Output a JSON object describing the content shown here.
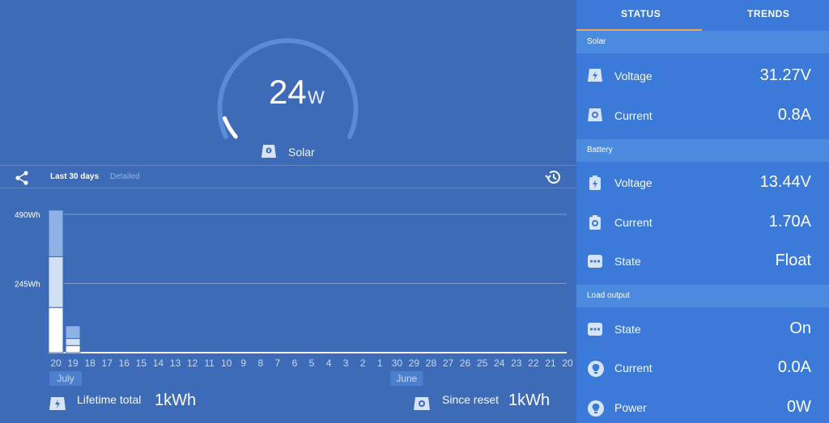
{
  "gauge": {
    "value": "24",
    "unit": "W",
    "label": "Solar",
    "level_fraction": 0.07
  },
  "toolbar": {
    "range_tab": "Last 30 days",
    "detail_tab": "Detailed"
  },
  "chart_data": {
    "type": "bar",
    "y_ticks": [
      "490Wh",
      "245Wh"
    ],
    "ylim": [
      0,
      490
    ],
    "x_labels": [
      "20",
      "19",
      "18",
      "17",
      "16",
      "15",
      "14",
      "13",
      "12",
      "11",
      "10",
      "9",
      "8",
      "7",
      "6",
      "5",
      "4",
      "3",
      "2",
      "1",
      "30",
      "29",
      "28",
      "27",
      "26",
      "25",
      "24",
      "23",
      "22",
      "21",
      "20"
    ],
    "months": [
      "July",
      "June"
    ],
    "series": [
      {
        "values": [
          160,
          25,
          0,
          0,
          0,
          0,
          0,
          0,
          0,
          0,
          0,
          0,
          0,
          0,
          0,
          0,
          0,
          0,
          0,
          0,
          0,
          0,
          0,
          0,
          0,
          0,
          0,
          0,
          0,
          0,
          0
        ]
      },
      {
        "values": [
          180,
          25,
          0,
          0,
          0,
          0,
          0,
          0,
          0,
          0,
          0,
          0,
          0,
          0,
          0,
          0,
          0,
          0,
          0,
          0,
          0,
          0,
          0,
          0,
          0,
          0,
          0,
          0,
          0,
          0,
          0
        ]
      },
      {
        "values": [
          165,
          45,
          0,
          0,
          0,
          0,
          0,
          0,
          0,
          0,
          0,
          0,
          0,
          0,
          0,
          0,
          0,
          0,
          0,
          0,
          0,
          0,
          0,
          0,
          0,
          0,
          0,
          0,
          0,
          0,
          0
        ]
      }
    ],
    "colors": [
      "#ffffff",
      "#d2e0f6",
      "#8fb2e6"
    ]
  },
  "footer": {
    "lifetime_label": "Lifetime total",
    "lifetime_value": "1kWh",
    "reset_label": "Since reset",
    "reset_value": "1kWh"
  },
  "tabs": {
    "status": "STATUS",
    "trends": "TRENDS"
  },
  "solar": {
    "header": "Solar",
    "voltage_label": "Voltage",
    "voltage_value": "31.27V",
    "current_label": "Current",
    "current_value": "0.8A"
  },
  "battery": {
    "header": "Battery",
    "voltage_label": "Voltage",
    "voltage_value": "13.44V",
    "current_label": "Current",
    "current_value": "1.70A",
    "state_label": "State",
    "state_value": "Float"
  },
  "load": {
    "header": "Load output",
    "state_label": "State",
    "state_value": "On",
    "current_label": "Current",
    "current_value": "0.0A",
    "power_label": "Power",
    "power_value": "0W"
  },
  "icons": {
    "solar-panel-icon": "solar panel",
    "battery-icon": "battery",
    "current-icon": "current",
    "state-icon": "dots",
    "bulb-icon": "bulb",
    "share-icon": "share",
    "history-icon": "history"
  }
}
